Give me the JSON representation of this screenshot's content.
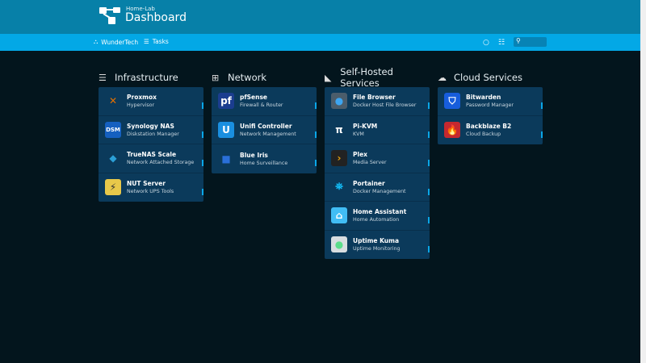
{
  "header": {
    "subtitle": "Home-Lab",
    "title": "Dashboard"
  },
  "nav": {
    "links": [
      {
        "label": "WunderTech",
        "icon": "sitemap-icon"
      },
      {
        "label": "Tasks",
        "icon": "list-icon"
      }
    ],
    "search_placeholder": ""
  },
  "colors": {
    "header": "#0780a8",
    "nav": "#03a8e6",
    "background": "#03151d",
    "card": "#0b3a5b",
    "indicator": "#0aa6e8"
  },
  "groups": [
    {
      "title": "Infrastructure",
      "icon": "server-icon",
      "items": [
        {
          "name": "Proxmox",
          "desc": "Hypervisor",
          "glyph": "✕",
          "bg": "transparent",
          "fg": "#e57000"
        },
        {
          "name": "Synology NAS",
          "desc": "Diskstation Manager",
          "glyph": "DSM",
          "bg": "#1560c0",
          "fg": "#fff"
        },
        {
          "name": "TrueNAS Scale",
          "desc": "Network Attached Storage",
          "glyph": "◆",
          "bg": "transparent",
          "fg": "#2b9fd6"
        },
        {
          "name": "NUT Server",
          "desc": "Network UPS Tools",
          "glyph": "⚡",
          "bg": "#e8c84a",
          "fg": "#333"
        }
      ]
    },
    {
      "title": "Network",
      "icon": "network-icon",
      "items": [
        {
          "name": "pfSense",
          "desc": "Firewall & Router",
          "glyph": "pf",
          "bg": "#1b3d8f",
          "fg": "#fff"
        },
        {
          "name": "Unifi Controller",
          "desc": "Network Management",
          "glyph": "U",
          "bg": "#1a8fe0",
          "fg": "#fff"
        },
        {
          "name": "Blue Iris",
          "desc": "Home Surveillance",
          "glyph": "■",
          "bg": "transparent",
          "fg": "#2a6fd8"
        }
      ]
    },
    {
      "title": "Self-Hosted Services",
      "icon": "satellite-dish-icon",
      "items": [
        {
          "name": "File Browser",
          "desc": "Docker Host File Browser",
          "glyph": "●",
          "bg": "#4b5d6b",
          "fg": "#3da5f0"
        },
        {
          "name": "Pi-KVM",
          "desc": "KVM",
          "glyph": "π",
          "bg": "transparent",
          "fg": "#fff"
        },
        {
          "name": "Plex",
          "desc": "Media Server",
          "glyph": "›",
          "bg": "#222",
          "fg": "#e5a00d"
        },
        {
          "name": "Portainer",
          "desc": "Docker Management",
          "glyph": "⛯",
          "bg": "transparent",
          "fg": "#13bef9"
        },
        {
          "name": "Home Assistant",
          "desc": "Home Automation",
          "glyph": "⌂",
          "bg": "#41bdf5",
          "fg": "#fff"
        },
        {
          "name": "Uptime Kuma",
          "desc": "Uptime Monitoring",
          "glyph": "●",
          "bg": "#d8dde0",
          "fg": "#5cdd8b"
        }
      ]
    },
    {
      "title": "Cloud Services",
      "icon": "cloud-icon",
      "items": [
        {
          "name": "Bitwarden",
          "desc": "Password Manager",
          "glyph": "⛉",
          "bg": "#175ddc",
          "fg": "#fff"
        },
        {
          "name": "Backblaze B2",
          "desc": "Cloud Backup",
          "glyph": "🔥",
          "bg": "#c5282f",
          "fg": "#fff"
        }
      ]
    }
  ]
}
